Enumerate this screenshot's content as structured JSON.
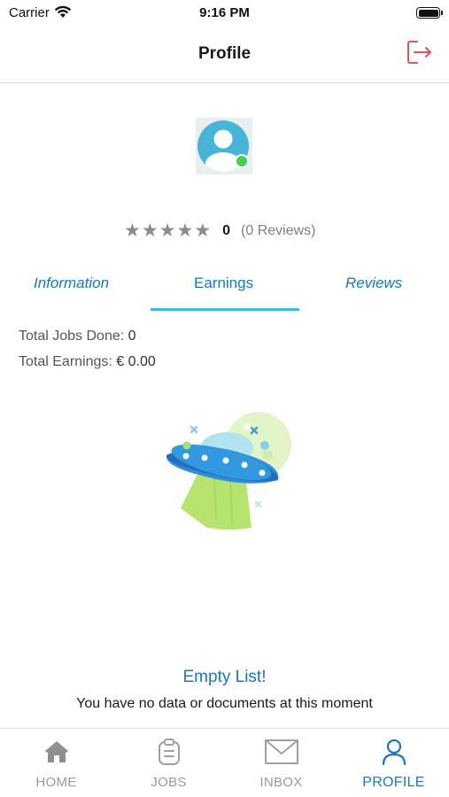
{
  "status_bar": {
    "carrier": "Carrier",
    "time": "9:16 PM"
  },
  "header": {
    "title": "Profile",
    "logout_icon": "logout-icon",
    "accent_color": "#e55353"
  },
  "profile": {
    "avatar_icon": "user-avatar-icon",
    "online": true,
    "rating": {
      "stars_max": 5,
      "stars_filled": 0,
      "value": "0",
      "reviews_label": "(0 Reviews)"
    }
  },
  "tabs": [
    {
      "label": "Information",
      "active": false
    },
    {
      "label": "Earnings",
      "active": true
    },
    {
      "label": "Reviews",
      "active": false
    }
  ],
  "earnings": {
    "jobs_label": "Total Jobs Done:",
    "jobs_value": "0",
    "earnings_label": "Total Earnings:",
    "earnings_value": "€ 0.00"
  },
  "empty_state": {
    "illustration": "ufo-illustration",
    "title": "Empty List!",
    "message": "You have no data or documents at this moment"
  },
  "bottom_nav": [
    {
      "label": "HOME",
      "icon": "home-icon",
      "active": false
    },
    {
      "label": "JOBS",
      "icon": "clipboard-icon",
      "active": false
    },
    {
      "label": "INBOX",
      "icon": "mail-icon",
      "active": false
    },
    {
      "label": "PROFILE",
      "icon": "person-icon",
      "active": true
    }
  ],
  "colors": {
    "primary": "#1877c5",
    "tab_indicator": "#3bbbe0",
    "online": "#3fd24c",
    "inactive": "#9a9a9a"
  }
}
